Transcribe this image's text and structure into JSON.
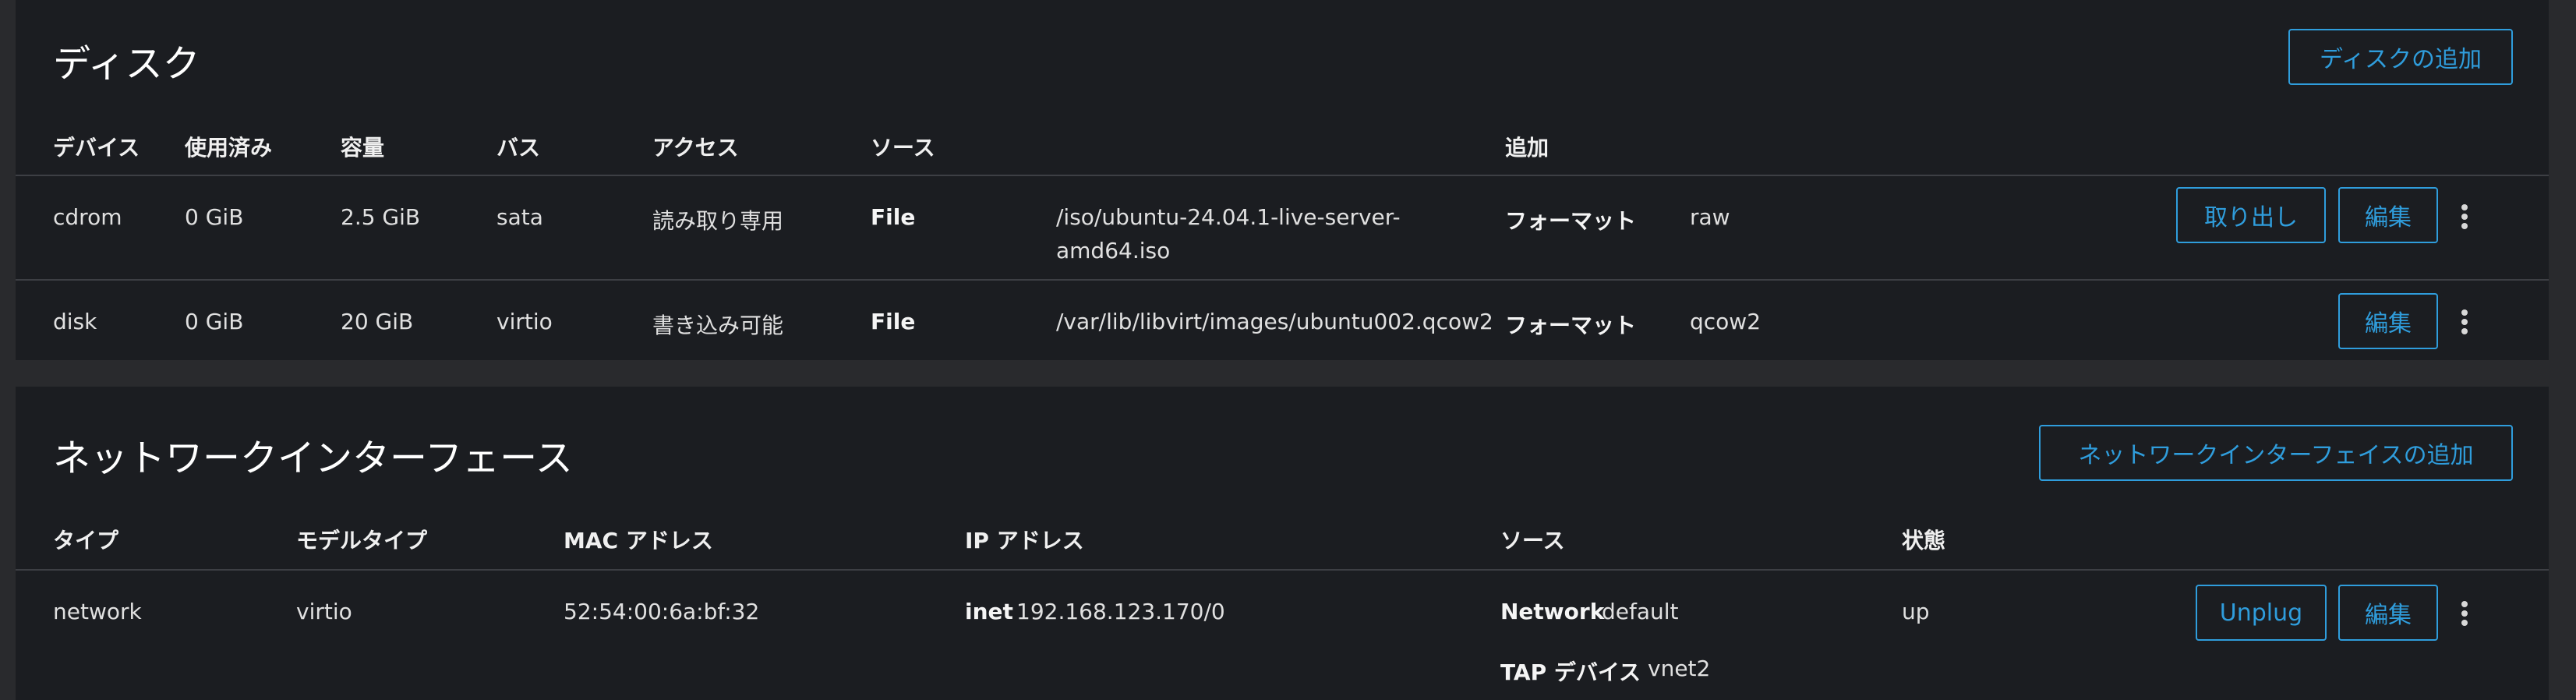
{
  "disks": {
    "title": "ディスク",
    "add_button": "ディスクの追加",
    "headers": [
      "デバイス",
      "使用済み",
      "容量",
      "バス",
      "アクセス",
      "ソース",
      "追加"
    ],
    "rows": [
      {
        "device": "cdrom",
        "used": "0 GiB",
        "capacity": "2.5 GiB",
        "bus": "sata",
        "access": "読み取り専用",
        "source_label": "File",
        "source_line1": "/iso/ubuntu-24.04.1-live-server-",
        "source_line2": "amd64.iso",
        "extra_label": "フォーマット",
        "extra_value": "raw",
        "eject_button": "取り出し",
        "edit_button": "編集"
      },
      {
        "device": "disk",
        "used": "0 GiB",
        "capacity": "20 GiB",
        "bus": "virtio",
        "access": "書き込み可能",
        "source_label": "File",
        "source_line1": "/var/lib/libvirt/images/ubuntu002.qcow2",
        "extra_label": "フォーマット",
        "extra_value": "qcow2",
        "edit_button": "編集"
      }
    ]
  },
  "nics": {
    "title": "ネットワークインターフェース",
    "add_button": "ネットワークインターフェイスの追加",
    "headers": [
      "タイプ",
      "モデルタイプ",
      "MAC アドレス",
      "IP アドレス",
      "ソース",
      "状態"
    ],
    "rows": [
      {
        "type": "network",
        "model": "virtio",
        "mac": "52:54:00:6a:bf:32",
        "ip_label": "inet",
        "ip_value": "192.168.123.170/0",
        "source_label": "Network",
        "source_value": "default",
        "tap_label": "TAP デバイス",
        "tap_value": "vnet2",
        "state": "up",
        "unplug_button": "Unplug",
        "edit_button": "編集"
      }
    ]
  },
  "icons": {
    "kebab": "kebab-menu-icon"
  },
  "colors": {
    "accent": "#2f9ddc",
    "card_bg": "#1b1d21",
    "page_bg": "#292a2d"
  }
}
